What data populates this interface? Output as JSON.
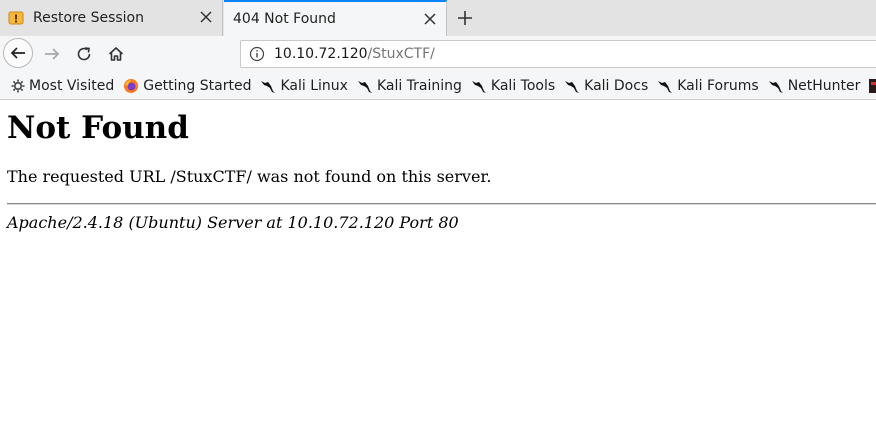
{
  "browser": {
    "tabs": [
      {
        "title": "Restore Session",
        "active": false
      },
      {
        "title": "404 Not Found",
        "active": true
      }
    ],
    "url": {
      "host": "10.10.72.120",
      "path": "/StuxCTF/"
    },
    "bookmarks": [
      {
        "label": "Most Visited",
        "icon": "gear-icon"
      },
      {
        "label": "Getting Started",
        "icon": "firefox-icon"
      },
      {
        "label": "Kali Linux",
        "icon": "kali-dragon-icon"
      },
      {
        "label": "Kali Training",
        "icon": "kali-dragon-icon"
      },
      {
        "label": "Kali Tools",
        "icon": "kali-dragon-icon"
      },
      {
        "label": "Kali Docs",
        "icon": "kali-dragon-icon"
      },
      {
        "label": "Kali Forums",
        "icon": "kali-dragon-icon"
      },
      {
        "label": "NetHunter",
        "icon": "kali-dragon-icon"
      }
    ],
    "accent_color": "#0a84ff"
  },
  "page": {
    "heading": "Not Found",
    "message": "The requested URL /StuxCTF/ was not found on this server.",
    "signature": "Apache/2.4.18 (Ubuntu) Server at 10.10.72.120 Port 80"
  }
}
